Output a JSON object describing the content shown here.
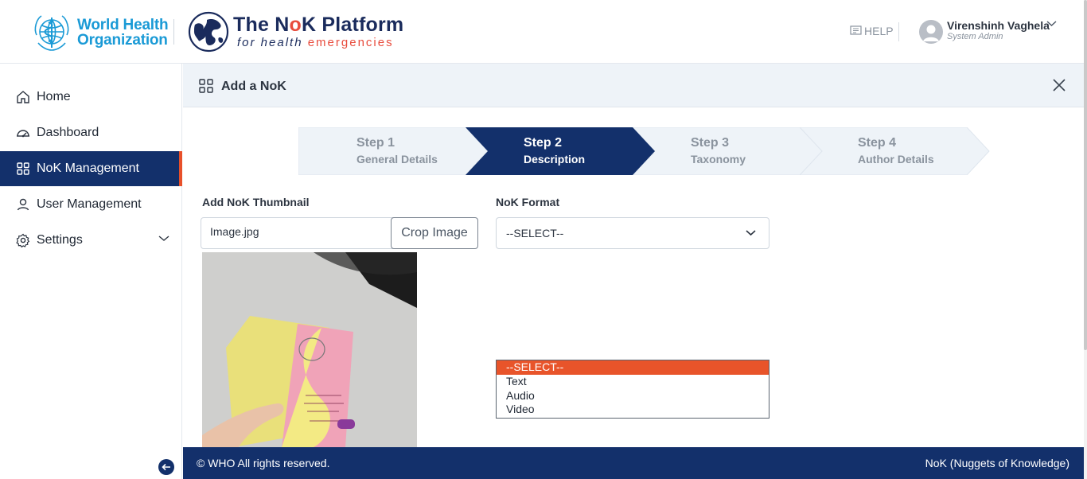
{
  "header": {
    "who_line1": "World Health",
    "who_line2": "Organization",
    "platform_title_a": "The N",
    "platform_title_o": "o",
    "platform_title_b": "K Platform",
    "platform_sub_a": "for health",
    "platform_sub_b": "emergencies",
    "help_label": "HELP",
    "user_name": "Virenshinh Vaghela",
    "user_role": "System Admin"
  },
  "sidebar": {
    "items": [
      {
        "label": "Home",
        "icon": "home-icon"
      },
      {
        "label": "Dashboard",
        "icon": "dashboard-gauge-icon"
      },
      {
        "label": "NoK Management",
        "icon": "grid-icon",
        "active": true
      },
      {
        "label": "User Management",
        "icon": "user-icon"
      },
      {
        "label": "Settings",
        "icon": "gear-icon"
      }
    ]
  },
  "page": {
    "title": "Add a NoK",
    "steps": [
      {
        "num": "Step 1",
        "label": "General Details"
      },
      {
        "num": "Step 2",
        "label": "Description",
        "active": true
      },
      {
        "num": "Step 3",
        "label": "Taxonomy"
      },
      {
        "num": "Step 4",
        "label": "Author Details"
      }
    ],
    "thumbnail_label": "Add NoK Thumbnail",
    "thumbnail_file": "Image.jpg",
    "crop_button": "Crop Image",
    "format_label": "NoK Format",
    "format_value": "--SELECT--",
    "format_options": [
      "--SELECT--",
      "Text",
      "Audio",
      "Video"
    ]
  },
  "footer": {
    "left": "© WHO All rights reserved.",
    "right": "NoK (Nuggets of Knowledge)"
  },
  "colors": {
    "navy": "#13306b",
    "accent": "#e8542a",
    "who_blue": "#1a9ad6"
  }
}
